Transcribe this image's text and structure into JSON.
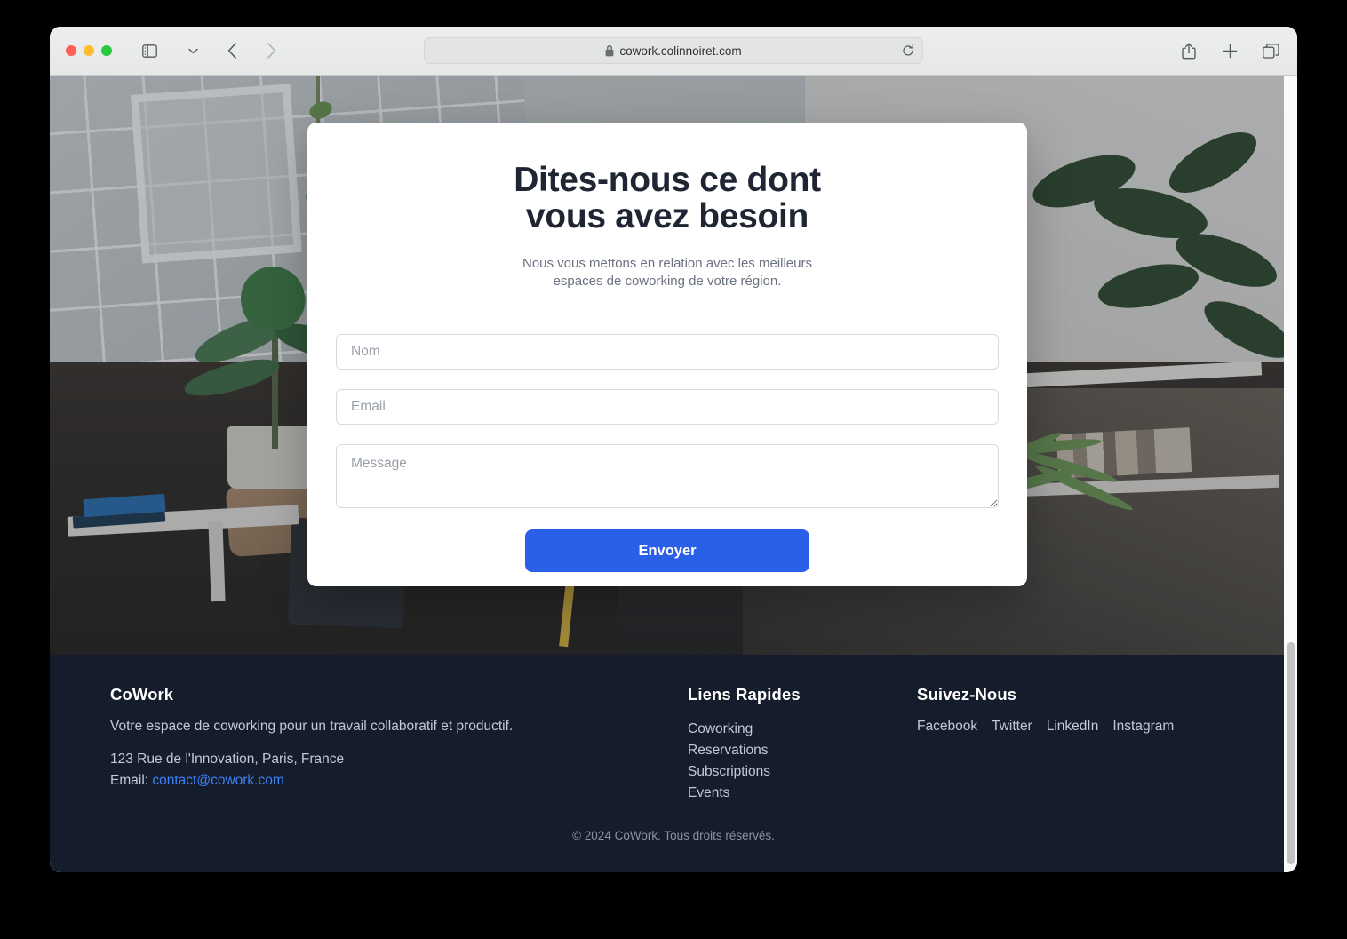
{
  "browser": {
    "url": "cowork.colinnoiret.com",
    "lock_icon": "lock-icon",
    "reload_icon": "reload-icon",
    "sidebar_icon": "sidebar-icon",
    "chevron_icon": "chevron-down-icon",
    "back_icon": "back-arrow-icon",
    "forward_icon": "forward-arrow-icon",
    "share_icon": "share-icon",
    "newtab_icon": "plus-icon",
    "tabs_icon": "tab-overview-icon"
  },
  "contact": {
    "heading_line1": "Dites-nous ce dont",
    "heading_line2": "vous avez besoin",
    "subtitle": "Nous vous mettons en relation avec les meilleurs espaces de coworking de votre région.",
    "fields": {
      "name_placeholder": "Nom",
      "name_value": "",
      "email_placeholder": "Email",
      "email_value": "",
      "message_placeholder": "Message",
      "message_value": ""
    },
    "submit_label": "Envoyer",
    "accent_color": "#2a5fe8"
  },
  "footer": {
    "brand": "CoWork",
    "tagline": "Votre espace de coworking pour un travail collaboratif et productif.",
    "address": "123 Rue de l'Innovation, Paris, France",
    "email_label": "Email: ",
    "email": "contact@cowork.com",
    "links_heading": "Liens Rapides",
    "links": [
      {
        "label": "Coworking"
      },
      {
        "label": "Reservations"
      },
      {
        "label": "Subscriptions"
      },
      {
        "label": "Events"
      }
    ],
    "social_heading": "Suivez-Nous",
    "socials": [
      {
        "label": "Facebook"
      },
      {
        "label": "Twitter"
      },
      {
        "label": "LinkedIn"
      },
      {
        "label": "Instagram"
      }
    ],
    "copyright": "© 2024 CoWork. Tous droits réservés.",
    "background_color": "#151c2c",
    "link_color": "#3b82f6"
  }
}
